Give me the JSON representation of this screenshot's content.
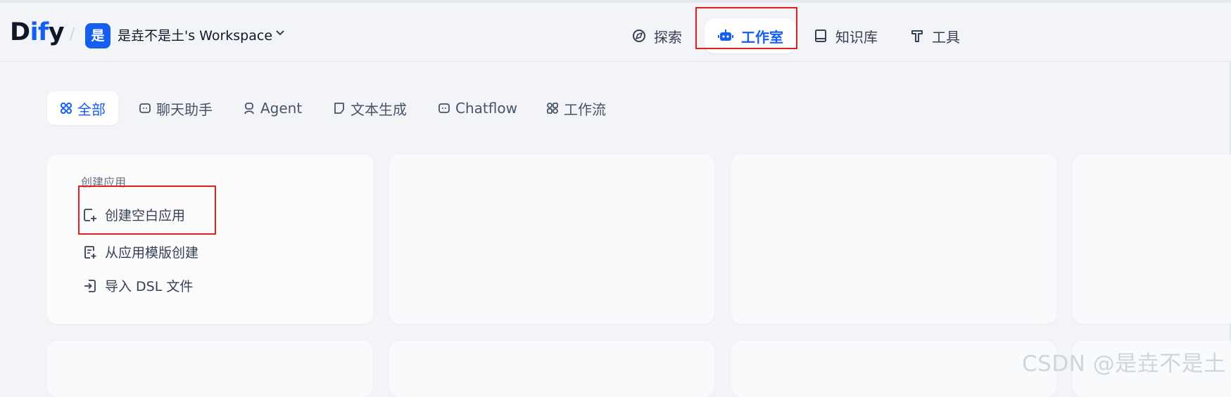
{
  "header": {
    "logo": {
      "pre": "D",
      "mid": "if",
      "post": "y"
    },
    "workspace": {
      "avatar": "是",
      "name": "是垚不是土's Workspace"
    },
    "nav": [
      {
        "label": "探索",
        "icon": "compass-icon"
      },
      {
        "label": "工作室",
        "icon": "robot-icon",
        "active": true
      },
      {
        "label": "知识库",
        "icon": "book-icon"
      },
      {
        "label": "工具",
        "icon": "hammer-icon"
      }
    ]
  },
  "filters": [
    {
      "label": "全部",
      "icon": "grid-icon",
      "active": true
    },
    {
      "label": "聊天助手",
      "icon": "chat-icon"
    },
    {
      "label": "Agent",
      "icon": "agent-icon"
    },
    {
      "label": "文本生成",
      "icon": "text-file-icon"
    },
    {
      "label": "Chatflow",
      "icon": "chatflow-icon"
    },
    {
      "label": "工作流",
      "icon": "workflow-icon"
    }
  ],
  "create_card": {
    "title": "创建应用",
    "actions": [
      {
        "label": "创建空白应用",
        "icon": "new-file-icon"
      },
      {
        "label": "从应用模版创建",
        "icon": "template-icon"
      },
      {
        "label": "导入 DSL 文件",
        "icon": "import-icon"
      }
    ]
  },
  "watermark": "CSDN @是垚不是土",
  "colors": {
    "accent": "#155eef",
    "highlight_box": "#e02020",
    "background": "#f2f4f7"
  }
}
